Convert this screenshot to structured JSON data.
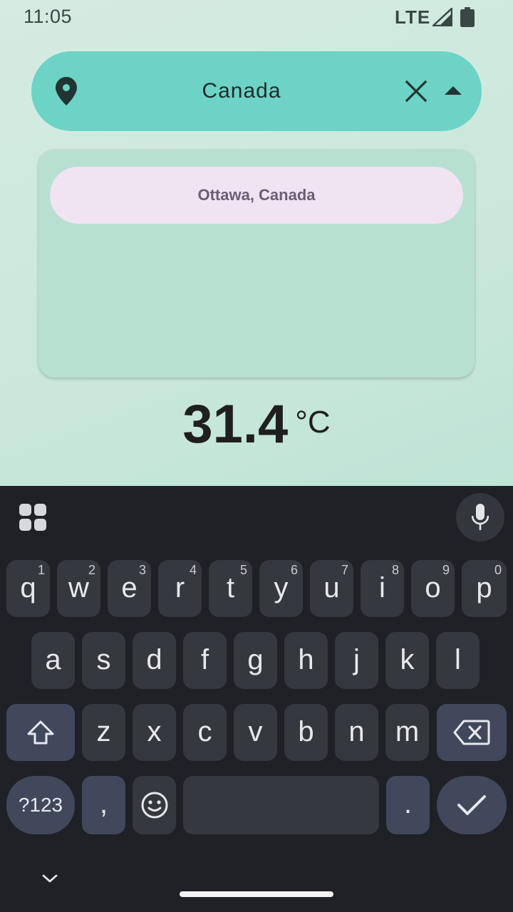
{
  "status_bar": {
    "time": "11:05",
    "network": "LTE",
    "icons": [
      "signal-icon",
      "battery-icon"
    ]
  },
  "search": {
    "value": "Canada",
    "icons": [
      "location-pin-icon",
      "close-icon",
      "arrow-up-icon"
    ]
  },
  "suggestions": [
    {
      "label": "Ottawa, Canada"
    }
  ],
  "weather": {
    "temperature": "31.4",
    "unit": "°C"
  },
  "keyboard": {
    "row1": [
      {
        "key": "q",
        "hint": "1"
      },
      {
        "key": "w",
        "hint": "2"
      },
      {
        "key": "e",
        "hint": "3"
      },
      {
        "key": "r",
        "hint": "4"
      },
      {
        "key": "t",
        "hint": "5"
      },
      {
        "key": "y",
        "hint": "6"
      },
      {
        "key": "u",
        "hint": "7"
      },
      {
        "key": "i",
        "hint": "8"
      },
      {
        "key": "o",
        "hint": "9"
      },
      {
        "key": "p",
        "hint": "0"
      }
    ],
    "row2": [
      "a",
      "s",
      "d",
      "f",
      "g",
      "h",
      "j",
      "k",
      "l"
    ],
    "row3": [
      "z",
      "x",
      "c",
      "v",
      "b",
      "n",
      "m"
    ],
    "symbols_label": "?123",
    "comma": ",",
    "period": ".",
    "icons": [
      "apps-grid-icon",
      "microphone-icon",
      "shift-icon",
      "backspace-icon",
      "emoji-icon",
      "checkmark-icon",
      "chevron-down-icon"
    ]
  },
  "colors": {
    "search_bar": "#6cd3c6",
    "suggest_panel": "#b8e0d1",
    "suggest_item": "#f0e4f3",
    "keyboard_bg": "#1f2126",
    "key_bg": "#35383e",
    "key_mod_bg": "#41485c"
  }
}
